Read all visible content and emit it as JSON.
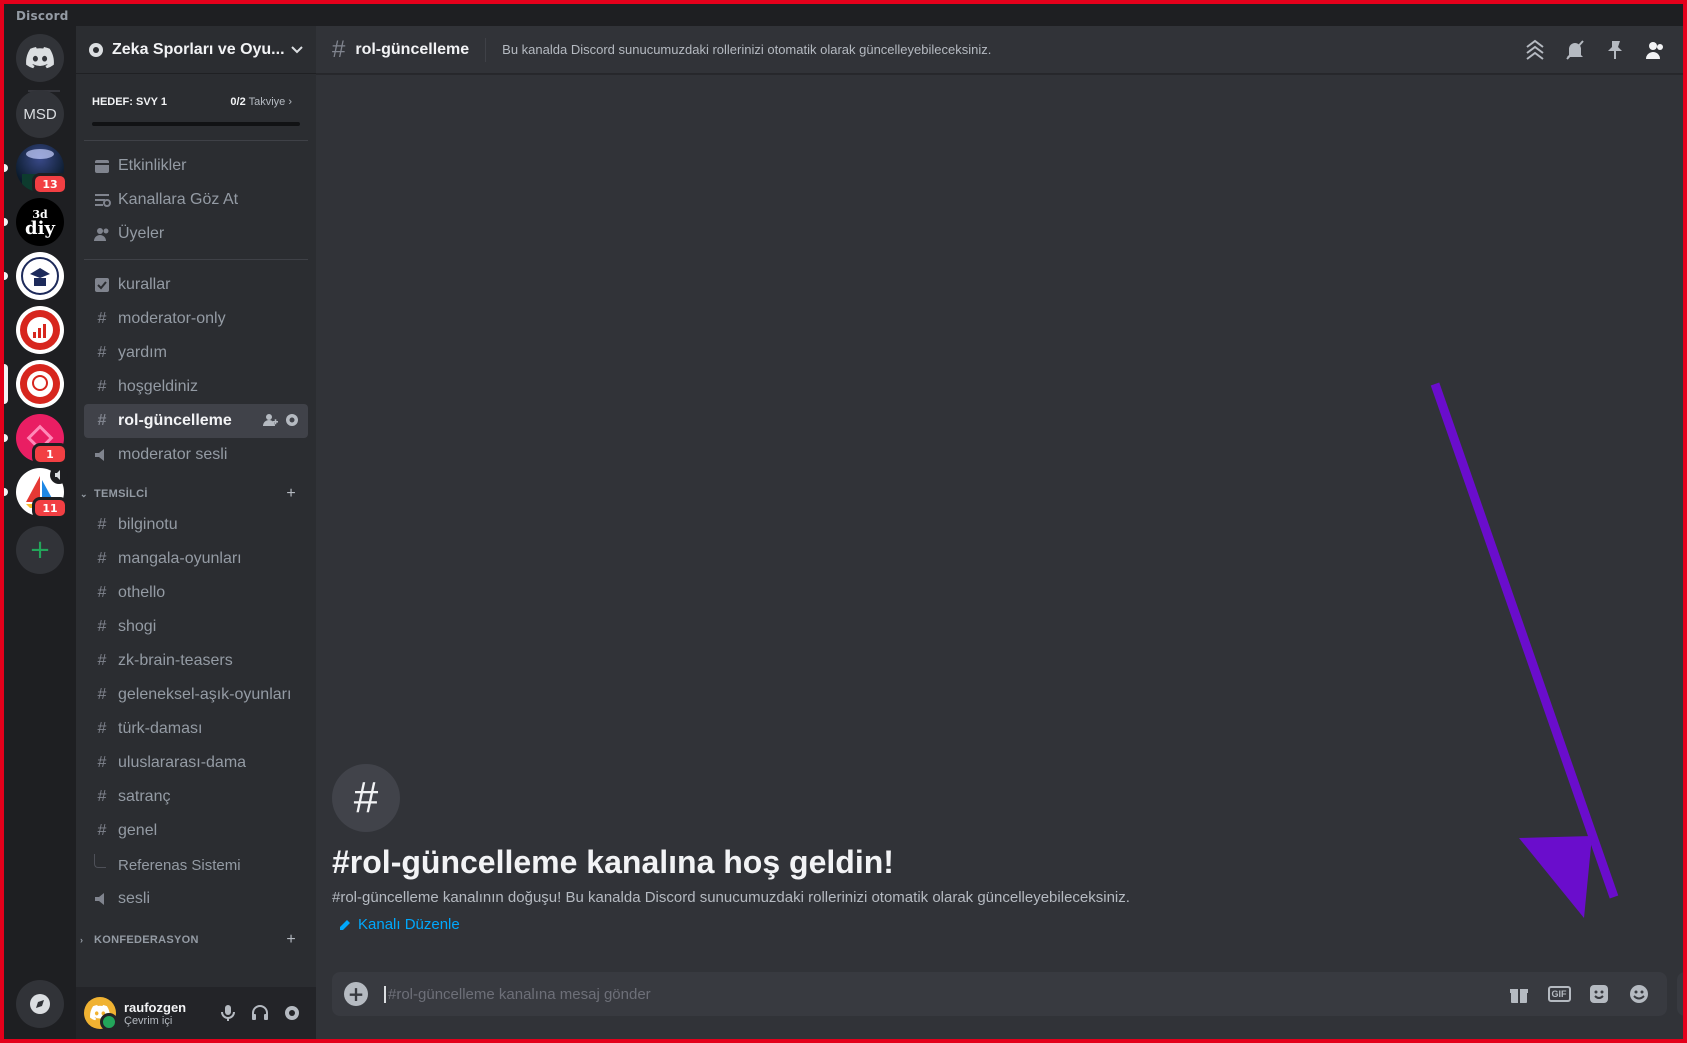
{
  "window": {
    "title": "Discord"
  },
  "rail": {
    "servers": [
      {
        "name": "direct-messages",
        "initials": "",
        "color": "#313338",
        "badge": ""
      },
      {
        "name": "msd",
        "initials": "MSD",
        "color": "#313338",
        "badge": ""
      },
      {
        "name": "server-dark-planet",
        "initials": "",
        "color": "#0f2a3a",
        "badge": "13"
      },
      {
        "name": "server-3d-diy",
        "initials": "3d diy",
        "color": "#000000",
        "badge": ""
      },
      {
        "name": "server-school-crest",
        "initials": "",
        "color": "#ffffff",
        "badge": ""
      },
      {
        "name": "server-red-logo",
        "initials": "",
        "color": "#ffffff",
        "badge": ""
      },
      {
        "name": "server-brain-logo",
        "initials": "",
        "color": "#ffffff",
        "badge": ""
      },
      {
        "name": "server-pink-diamond",
        "initials": "",
        "color": "#e91e63",
        "badge": "1"
      },
      {
        "name": "server-sailboat",
        "initials": "",
        "color": "#ffffff",
        "badge": "11"
      }
    ]
  },
  "sidebar": {
    "server_name": "Zeka Sporları ve Oyu...",
    "boost": {
      "goal": "HEDEF: SVY 1",
      "count": "0/2",
      "unit": "Takviye",
      "progress": 0
    },
    "top_items": [
      {
        "label": "Etkinlikler",
        "icon": "calendar-icon"
      },
      {
        "label": "Kanallara Göz At",
        "icon": "browse-channels-icon"
      },
      {
        "label": "Üyeler",
        "icon": "members-icon"
      }
    ],
    "channels": [
      {
        "label": "kurallar",
        "type": "rules"
      },
      {
        "label": "moderator-only",
        "type": "text"
      },
      {
        "label": "yardım",
        "type": "text"
      },
      {
        "label": "hoşgeldiniz",
        "type": "text"
      },
      {
        "label": "rol-güncelleme",
        "type": "text",
        "active": true
      },
      {
        "label": "moderator sesli",
        "type": "voice"
      }
    ],
    "category_1": "TEMSİLCİ",
    "category_1_channels": [
      {
        "label": "bilginotu",
        "type": "text"
      },
      {
        "label": "mangala-oyunları",
        "type": "text"
      },
      {
        "label": "othello",
        "type": "text"
      },
      {
        "label": "shogi",
        "type": "text"
      },
      {
        "label": "zk-brain-teasers",
        "type": "text"
      },
      {
        "label": "geleneksel-aşık-oyunları",
        "type": "text"
      },
      {
        "label": "türk-daması",
        "type": "text"
      },
      {
        "label": "uluslararası-dama",
        "type": "text"
      },
      {
        "label": "satranç",
        "type": "text"
      },
      {
        "label": "genel",
        "type": "text"
      }
    ],
    "thread": "Referenas Sistemi",
    "voice_channel": "sesli",
    "category_2": "KONFEDERASYON"
  },
  "user": {
    "name": "raufozgen",
    "status": "Çevrim içi"
  },
  "main": {
    "channel_name": "rol-güncelleme",
    "topic": "Bu kanalda Discord sunucumuzdaki rollerinizi otomatik olarak güncelleyebileceksiniz.",
    "welcome_title": "#rol-güncelleme kanalına hoş geldin!",
    "welcome_text": "#rol-güncelleme kanalının doğuşu! Bu kanalda Discord sunucumuzdaki rollerinizi otomatik olarak güncelleyebileceksiniz.",
    "edit_channel": "Kanalı Düzenle",
    "composer_placeholder": "#rol-güncelleme kanalına mesaj gönder",
    "gif_label": "GIF"
  },
  "colors": {
    "accent_link": "#00a8fc",
    "online": "#23a55a",
    "badge": "#f23f43",
    "arrow": "#6a0dcc"
  }
}
